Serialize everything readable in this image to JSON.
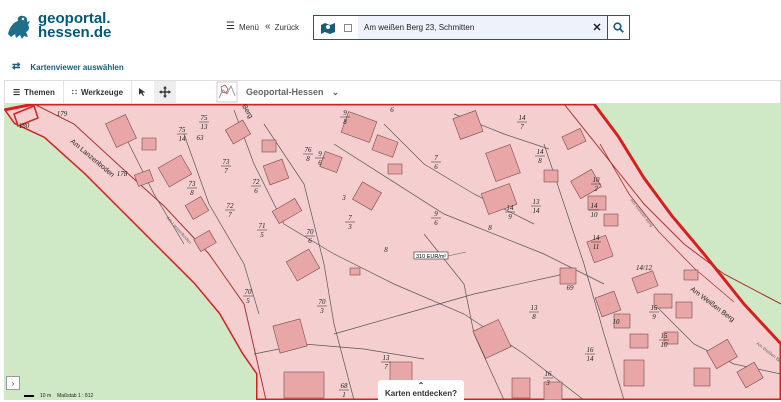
{
  "brand": {
    "line1": "geoportal.",
    "line2": "hessen.de"
  },
  "header": {
    "menu_label": "Menü",
    "back_label": "Zurück"
  },
  "search": {
    "value": "Am weißen Berg 23, Schmitten"
  },
  "viewer": {
    "label": "Kartenviewer auswählen"
  },
  "toolbar": {
    "themes_label": "Themen",
    "tools_label": "Werkzeuge",
    "theme_name": "Geoportal-Hessen"
  },
  "map": {
    "price_label": "310 EUR/m²",
    "streets": [
      "Am Lanzenboden",
      "Am Lanzenboden",
      "Am Weißen Berg",
      "Am Weißen Berg",
      "Am Weißen Berg",
      "Berg"
    ],
    "lot_top": [
      "75",
      "75",
      "73",
      "72",
      "72",
      "71",
      "70",
      "70",
      "70",
      "13",
      "73",
      "76",
      "7",
      "9",
      "14",
      "14",
      "14",
      "13",
      "14",
      "14",
      "10",
      "13",
      "16",
      "16",
      "15",
      "15",
      "68",
      "14/12",
      "9",
      "7",
      "9"
    ],
    "lot_bottom": [
      "14",
      "13",
      "7",
      "6",
      "7",
      "5",
      "6",
      "5",
      "3",
      "7",
      "8",
      "8",
      "6",
      "8",
      "7",
      "8",
      "9",
      "14",
      "11",
      "10",
      "2",
      "8",
      "14",
      "3",
      "10",
      "9",
      "1",
      "",
      "6",
      "3",
      "6"
    ],
    "misc": [
      "180",
      "179",
      "63",
      "6",
      "3",
      "8",
      "8",
      "10",
      "178",
      "69"
    ]
  },
  "scale": {
    "distance": "10 m",
    "ratio": "Maßstab 1 : 812"
  },
  "discover_label": "Karten entdecken?",
  "colors": {
    "brand": "#005a78",
    "parcel_fill": "#f5cfcf",
    "boundary": "#d62020",
    "meadow": "#cfe8c5"
  }
}
